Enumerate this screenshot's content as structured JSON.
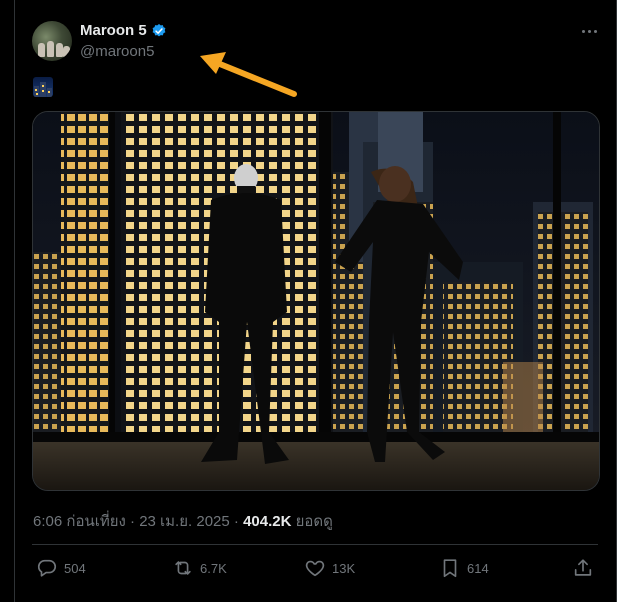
{
  "author": {
    "display_name": "Maroon 5",
    "handle": "@maroon5",
    "verified": true,
    "avatar_icon": "band-photo-avatar"
  },
  "tweet": {
    "emoji_icon": "night-city-emoji",
    "media_icon": "photo-two-people-city-night-window",
    "time": "6:06 ก่อนเที่ยง",
    "separator": "·",
    "date": "23 เม.ย. 2025",
    "views_count": "404.2K",
    "views_label": "ยอดดู"
  },
  "actions": {
    "reply": "504",
    "retweet": "6.7K",
    "like": "13K",
    "bookmark": "614"
  },
  "colors": {
    "background": "#000000",
    "text_primary": "#e7e9ea",
    "text_secondary": "#71767b",
    "verified_blue": "#1d9bf0",
    "annotation_arrow": "#f5a623"
  }
}
